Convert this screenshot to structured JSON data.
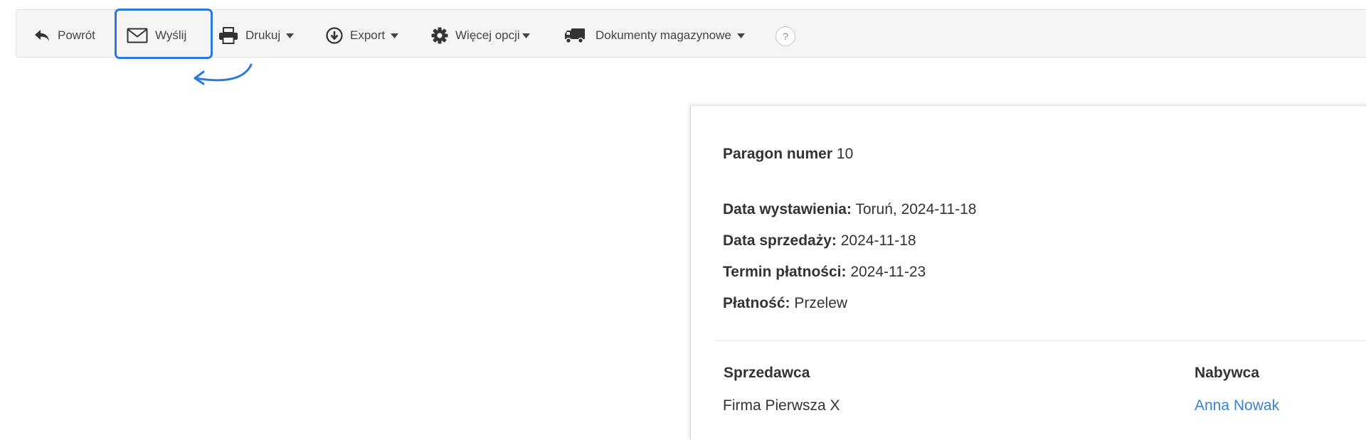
{
  "toolbar": {
    "back_label": "Powrót",
    "send_label": "Wyślij",
    "print_label": "Drukuj",
    "export_label": "Export",
    "more_label": "Więcej opcji",
    "warehouse_label": "Dokumenty magazynowe",
    "help_label": "?"
  },
  "document": {
    "title_label": "Paragon numer",
    "title_value": "10",
    "issue_date_label": "Data wystawienia:",
    "issue_date_value": "Toruń, 2024-11-18",
    "sale_date_label": "Data sprzedaży:",
    "sale_date_value": "2024-11-18",
    "due_date_label": "Termin płatności:",
    "due_date_value": "2024-11-23",
    "payment_label": "Płatność:",
    "payment_value": "Przelew",
    "seller_heading": "Sprzedawca",
    "seller_name": "Firma Pierwsza X",
    "buyer_heading": "Nabywca",
    "buyer_name": "Anna Nowak"
  },
  "colors": {
    "highlight": "#2a79e0",
    "link": "#3a82d1",
    "toolbar_bg": "#f5f5f5"
  },
  "icons": [
    "reply-icon",
    "envelope-icon",
    "printer-icon",
    "download-circle-icon",
    "gear-icon",
    "truck-icon",
    "caret-down-icon",
    "question-icon",
    "curved-arrow-icon"
  ]
}
